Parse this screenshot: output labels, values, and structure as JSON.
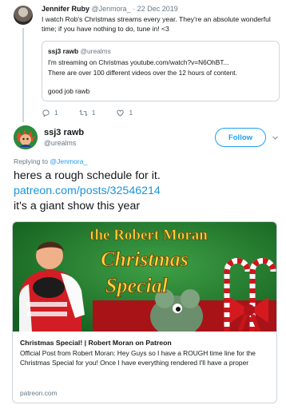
{
  "parent_tweet": {
    "author_name": "Jennifer Ruby",
    "author_handle_date": "@Jenmora_ · 22 Dec 2019",
    "text": "I watch Rob's Christmas streams every year. They're an absolute wonderful time; if you have nothing to do, tune in! <3",
    "quoted": {
      "author_name": "ssj3 rawb",
      "author_handle": "@urealms",
      "line1": "I'm streaming on Christmas youtube.com/watch?v=N6OhBT...",
      "line2": "There are over 100 different videos over the 12 hours of content.",
      "line3": "good job rawb"
    },
    "actions": {
      "reply_count": "1",
      "retweet_count": "1",
      "like_count": "1"
    }
  },
  "main_tweet": {
    "author_name": "ssj3 rawb",
    "author_handle": "@urealms",
    "follow_label": "Follow",
    "replying_prefix": "Replying to",
    "replying_handle": "@Jenmora_",
    "text_line1": "heres a rough schedule for it.",
    "text_link": "patreon.com/posts/32546214",
    "text_line3": "it's a giant show this year"
  },
  "card": {
    "image_title_line1": "the Robert Moran",
    "image_title_line2": "Christmas",
    "image_title_line3": "Special",
    "title": "Christmas Special! | Robert Moran on Patreon",
    "description": "Official Post from Robert Moran: Hey Guys so I have a ROUGH time line for the Christmas Special for you! Once I have everything rendered I'll have a proper",
    "domain": "patreon.com"
  },
  "colors": {
    "accent": "#1da1f2",
    "link": "#1b95e0",
    "muted": "#657786",
    "border": "#ccd6dd",
    "card_green": "#1f7a2e",
    "card_red": "#c8151b"
  },
  "icons": [
    "reply-icon",
    "retweet-icon",
    "like-icon",
    "chevron-down-icon"
  ]
}
